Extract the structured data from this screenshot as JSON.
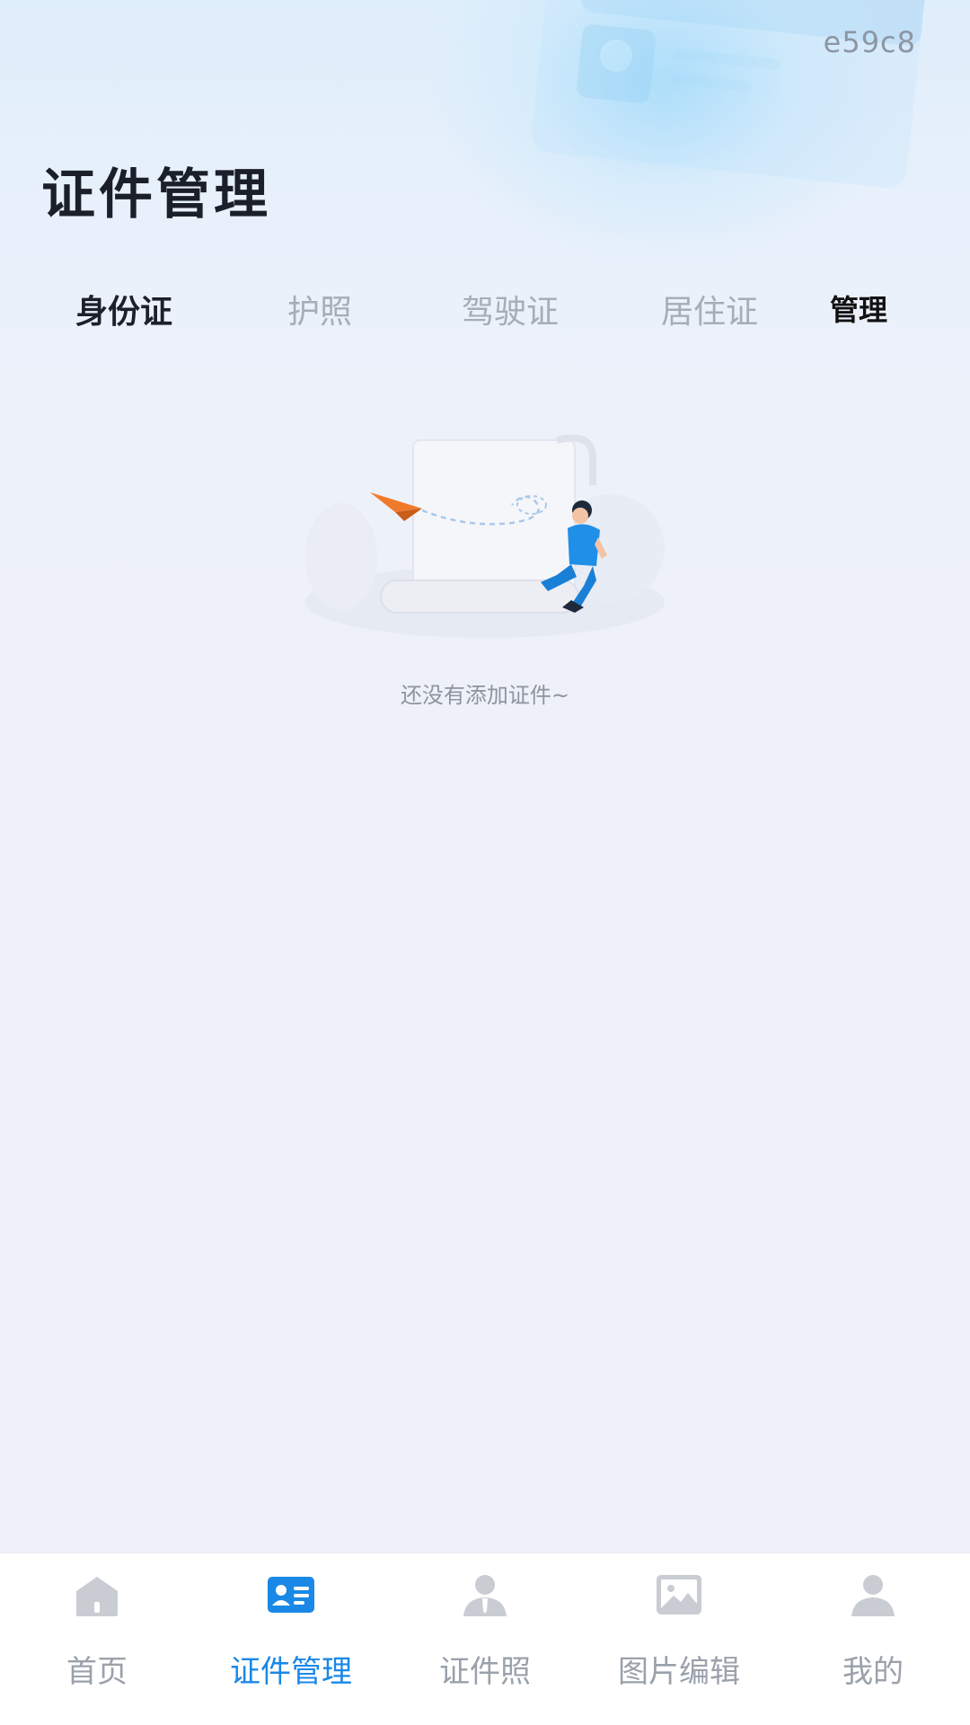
{
  "tag": "e59c8",
  "page_title": "证件管理",
  "tabs": [
    {
      "label": "身份证",
      "active": true
    },
    {
      "label": "护照",
      "active": false
    },
    {
      "label": "驾驶证",
      "active": false
    },
    {
      "label": "居住证",
      "active": false
    }
  ],
  "manage_label": "管理",
  "empty_state": {
    "text": "还没有添加证件~"
  },
  "tabbar": [
    {
      "label": "首页",
      "icon": "home-icon",
      "active": false
    },
    {
      "label": "证件管理",
      "icon": "id-card-icon",
      "active": true
    },
    {
      "label": "证件照",
      "icon": "id-photo-icon",
      "active": false
    },
    {
      "label": "图片编辑",
      "icon": "image-icon",
      "active": false
    },
    {
      "label": "我的",
      "icon": "user-icon",
      "active": false
    }
  ],
  "colors": {
    "accent": "#1a88e6",
    "inactive": "#9aa1ab",
    "title": "#1b1f29",
    "background": "#eef1f9"
  }
}
